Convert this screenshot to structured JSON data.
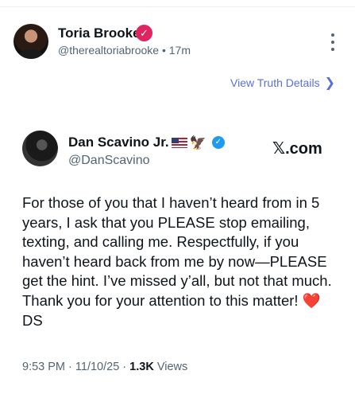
{
  "truth_post": {
    "author_name": "Toria Brooke",
    "verified_icon": "✓",
    "author_handle": "@therealtoriabrooke",
    "separator": "•",
    "time_ago": "17m",
    "view_details_label": "View Truth Details",
    "view_details_chevron": "❯"
  },
  "x_post": {
    "author_name": "Dan Scavino Jr.",
    "eagle_emoji": "🦅",
    "verified_icon": "✓",
    "author_handle": "@DanScavino",
    "source": "𝕏.com",
    "text_before_heart": "For those of you that I haven’t heard from in 5 years, I ask that you PLEASE stop emailing, texting, and calling me. Respectfully, if you haven’t heard back from me by now—PLEASE get the hint. I’ve missed y’all, but not that much. Thank you for your attention to this matter! ",
    "heart": "❤️",
    "text_after_heart": "DS",
    "time": "9:53 PM",
    "dot1": " · ",
    "date": "11/10/25",
    "dot2": " · ",
    "views_count": "1.3K",
    "views_label": " Views"
  },
  "colors": {
    "truth_verified": "#e0245e",
    "x_verified": "#1d9bf0",
    "link": "#5b6fd6"
  }
}
